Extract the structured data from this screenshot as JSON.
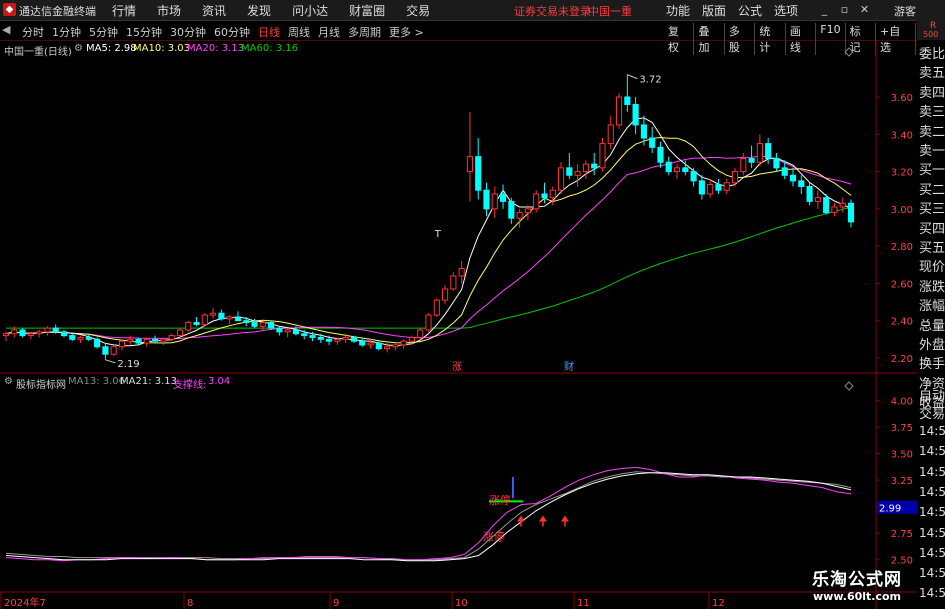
{
  "titlebar": {
    "app_name": "通达信金融终端",
    "menu": [
      "行情",
      "市场",
      "资讯",
      "发现",
      "问小达",
      "财富圈",
      "交易"
    ],
    "warning": "证券交易未登录",
    "stock": "中国一重",
    "right_menu": [
      "功能",
      "版面",
      "公式",
      "选项"
    ],
    "guest": "游客"
  },
  "periods": {
    "items": [
      "分时",
      "1分钟",
      "5分钟",
      "15分钟",
      "30分钟",
      "60分钟",
      "日线",
      "周线",
      "月线",
      "多周期",
      "更多 >"
    ],
    "active": "日线"
  },
  "toolbar": [
    "复权",
    "叠加",
    "多股",
    "统计",
    "画线",
    "F10",
    "标记",
    "+自选",
    "返回"
  ],
  "rbox": {
    "a": "R",
    "b": "500"
  },
  "main_panel": {
    "title": "中国一重(日线)",
    "ma5": "MA5: 2.98",
    "ma10": "MA10: 3.03",
    "ma20": "MA20: 3.13",
    "ma60": "MA60: 3.16",
    "y_ticks": [
      "3.60",
      "3.40",
      "3.20",
      "3.00",
      "2.80",
      "2.60",
      "2.40",
      "2.20"
    ],
    "y_range": [
      2.13,
      3.82
    ],
    "high_label": "3.72",
    "low_label": "2.19",
    "t_label": "T",
    "marker_zhang": "涨",
    "marker_cai": "财"
  },
  "sub_panel": {
    "title": "股标指标网",
    "ma13": "MA13: 3.06",
    "ma21": "MA21: 3.13",
    "support_name": "支撑线:",
    "support_val": "3.04",
    "y_ticks": [
      "4.00",
      "3.75",
      "3.50",
      "3.25",
      "3.00",
      "2.75",
      "2.50"
    ],
    "y_range": [
      2.45,
      4.1
    ],
    "current": "2.99",
    "zhangting1": "涨停",
    "zhangting2": "涨停"
  },
  "x_labels": [
    "2024年7",
    "8",
    "9",
    "10",
    "11",
    "12"
  ],
  "side_quote": [
    "委比",
    "卖五",
    "卖四",
    "卖三",
    "卖二",
    "卖一",
    "买一",
    "买二",
    "买三",
    "买四",
    "买五",
    "现价",
    "涨跌",
    "涨幅",
    "总量",
    "外盘",
    "换手",
    "净资",
    "收益"
  ],
  "side_auto": [
    "自动",
    "交易"
  ],
  "side_times": [
    "14:56",
    "14:56",
    "14:56",
    "14:56",
    "14:56",
    "14:56",
    "14:56",
    "14:56",
    "14:56"
  ],
  "watermark": {
    "line1": "乐淘公式网",
    "line2": "www.60lt.com"
  },
  "colors": {
    "up": "#ff3232",
    "down": "#00ffff",
    "ma5": "#ffffff",
    "ma10": "#ffff66",
    "ma20": "#ff40ff",
    "ma60": "#00c800",
    "axis": "#8b0000"
  },
  "chart_data": {
    "type": "candlestick",
    "candles": [
      [
        2.32,
        2.34,
        2.29,
        2.33
      ],
      [
        2.33,
        2.37,
        2.31,
        2.35
      ],
      [
        2.35,
        2.36,
        2.31,
        2.32
      ],
      [
        2.32,
        2.34,
        2.3,
        2.33
      ],
      [
        2.33,
        2.35,
        2.31,
        2.34
      ],
      [
        2.34,
        2.37,
        2.32,
        2.36
      ],
      [
        2.36,
        2.38,
        2.33,
        2.34
      ],
      [
        2.34,
        2.35,
        2.31,
        2.32
      ],
      [
        2.32,
        2.33,
        2.29,
        2.3
      ],
      [
        2.3,
        2.32,
        2.28,
        2.31
      ],
      [
        2.31,
        2.33,
        2.29,
        2.3
      ],
      [
        2.3,
        2.31,
        2.25,
        2.26
      ],
      [
        2.26,
        2.28,
        2.19,
        2.22
      ],
      [
        2.22,
        2.27,
        2.21,
        2.26
      ],
      [
        2.26,
        2.3,
        2.24,
        2.29
      ],
      [
        2.29,
        2.32,
        2.27,
        2.3
      ],
      [
        2.3,
        2.31,
        2.27,
        2.28
      ],
      [
        2.28,
        2.31,
        2.26,
        2.3
      ],
      [
        2.3,
        2.32,
        2.28,
        2.29
      ],
      [
        2.29,
        2.31,
        2.27,
        2.3
      ],
      [
        2.3,
        2.33,
        2.29,
        2.32
      ],
      [
        2.32,
        2.36,
        2.31,
        2.35
      ],
      [
        2.35,
        2.4,
        2.34,
        2.39
      ],
      [
        2.39,
        2.42,
        2.37,
        2.38
      ],
      [
        2.38,
        2.44,
        2.37,
        2.43
      ],
      [
        2.43,
        2.47,
        2.41,
        2.44
      ],
      [
        2.44,
        2.46,
        2.4,
        2.41
      ],
      [
        2.41,
        2.43,
        2.38,
        2.42
      ],
      [
        2.42,
        2.45,
        2.4,
        2.4
      ],
      [
        2.4,
        2.42,
        2.37,
        2.39
      ],
      [
        2.39,
        2.41,
        2.36,
        2.37
      ],
      [
        2.37,
        2.4,
        2.35,
        2.39
      ],
      [
        2.39,
        2.4,
        2.35,
        2.36
      ],
      [
        2.36,
        2.37,
        2.32,
        2.34
      ],
      [
        2.34,
        2.36,
        2.31,
        2.35
      ],
      [
        2.35,
        2.37,
        2.32,
        2.33
      ],
      [
        2.33,
        2.35,
        2.3,
        2.32
      ],
      [
        2.32,
        2.34,
        2.29,
        2.31
      ],
      [
        2.31,
        2.33,
        2.28,
        2.3
      ],
      [
        2.3,
        2.32,
        2.27,
        2.29
      ],
      [
        2.29,
        2.31,
        2.27,
        2.3
      ],
      [
        2.3,
        2.33,
        2.28,
        2.31
      ],
      [
        2.31,
        2.32,
        2.28,
        2.29
      ],
      [
        2.29,
        2.31,
        2.26,
        2.27
      ],
      [
        2.27,
        2.3,
        2.25,
        2.28
      ],
      [
        2.28,
        2.29,
        2.24,
        2.25
      ],
      [
        2.25,
        2.28,
        2.23,
        2.26
      ],
      [
        2.26,
        2.28,
        2.24,
        2.27
      ],
      [
        2.27,
        2.3,
        2.25,
        2.29
      ],
      [
        2.29,
        2.32,
        2.27,
        2.31
      ],
      [
        2.31,
        2.36,
        2.3,
        2.35
      ],
      [
        2.35,
        2.44,
        2.34,
        2.43
      ],
      [
        2.43,
        2.52,
        2.42,
        2.51
      ],
      [
        2.51,
        2.59,
        2.49,
        2.57
      ],
      [
        2.57,
        2.66,
        2.56,
        2.64
      ],
      [
        2.64,
        2.72,
        2.6,
        2.68
      ],
      [
        3.2,
        3.52,
        3.04,
        3.28
      ],
      [
        3.28,
        3.38,
        3.05,
        3.1
      ],
      [
        3.1,
        3.14,
        2.96,
        3.0
      ],
      [
        3.0,
        3.12,
        2.95,
        3.08
      ],
      [
        3.08,
        3.13,
        3.0,
        3.04
      ],
      [
        3.04,
        3.06,
        2.92,
        2.95
      ],
      [
        2.95,
        3.0,
        2.9,
        2.98
      ],
      [
        2.98,
        3.02,
        2.94,
        3.0
      ],
      [
        3.0,
        3.1,
        2.98,
        3.08
      ],
      [
        3.08,
        3.14,
        3.03,
        3.06
      ],
      [
        3.06,
        3.12,
        3.02,
        3.1
      ],
      [
        3.1,
        3.25,
        3.08,
        3.22
      ],
      [
        3.22,
        3.3,
        3.16,
        3.18
      ],
      [
        3.18,
        3.24,
        3.12,
        3.2
      ],
      [
        3.2,
        3.26,
        3.16,
        3.24
      ],
      [
        3.24,
        3.3,
        3.18,
        3.22
      ],
      [
        3.22,
        3.38,
        3.2,
        3.35
      ],
      [
        3.35,
        3.5,
        3.32,
        3.45
      ],
      [
        3.45,
        3.62,
        3.43,
        3.6
      ],
      [
        3.6,
        3.72,
        3.52,
        3.56
      ],
      [
        3.56,
        3.6,
        3.4,
        3.45
      ],
      [
        3.45,
        3.5,
        3.34,
        3.38
      ],
      [
        3.38,
        3.44,
        3.3,
        3.33
      ],
      [
        3.33,
        3.36,
        3.22,
        3.25
      ],
      [
        3.25,
        3.28,
        3.18,
        3.2
      ],
      [
        3.2,
        3.24,
        3.16,
        3.22
      ],
      [
        3.22,
        3.26,
        3.18,
        3.2
      ],
      [
        3.2,
        3.22,
        3.12,
        3.15
      ],
      [
        3.15,
        3.18,
        3.05,
        3.08
      ],
      [
        3.08,
        3.16,
        3.06,
        3.13
      ],
      [
        3.13,
        3.16,
        3.08,
        3.1
      ],
      [
        3.1,
        3.16,
        3.08,
        3.14
      ],
      [
        3.14,
        3.22,
        3.12,
        3.2
      ],
      [
        3.2,
        3.3,
        3.18,
        3.27
      ],
      [
        3.27,
        3.34,
        3.22,
        3.25
      ],
      [
        3.25,
        3.4,
        3.23,
        3.35
      ],
      [
        3.35,
        3.38,
        3.24,
        3.27
      ],
      [
        3.27,
        3.3,
        3.2,
        3.22
      ],
      [
        3.22,
        3.26,
        3.16,
        3.18
      ],
      [
        3.18,
        3.22,
        3.12,
        3.15
      ],
      [
        3.15,
        3.18,
        3.08,
        3.12
      ],
      [
        3.12,
        3.14,
        3.02,
        3.04
      ],
      [
        3.04,
        3.1,
        3.0,
        3.06
      ],
      [
        3.06,
        3.08,
        2.97,
        2.98
      ],
      [
        2.98,
        3.03,
        2.96,
        3.01
      ],
      [
        3.01,
        3.06,
        2.98,
        3.03
      ],
      [
        3.03,
        3.05,
        2.9,
        2.93
      ]
    ],
    "sub_lines": {
      "ma13": [
        2.52,
        2.51,
        2.5,
        2.5,
        2.49,
        2.5,
        2.5,
        2.51,
        2.52,
        2.52,
        2.51,
        2.52,
        2.52,
        2.51,
        2.5,
        2.5,
        2.5,
        2.51,
        2.52,
        2.52,
        2.52,
        2.53,
        2.53,
        2.53,
        2.52,
        2.52,
        2.51,
        2.5,
        2.5,
        2.5,
        2.51,
        2.52,
        2.55,
        2.66,
        2.82,
        2.95,
        3.02,
        3.03,
        3.1,
        3.18,
        3.25,
        3.3,
        3.34,
        3.36,
        3.37,
        3.35,
        3.31,
        3.28,
        3.28,
        3.3,
        3.29,
        3.27,
        3.26,
        3.25,
        3.23,
        3.22,
        3.2,
        3.18,
        3.14,
        3.12
      ],
      "ma21": [
        2.56,
        2.55,
        2.54,
        2.53,
        2.53,
        2.52,
        2.52,
        2.52,
        2.52,
        2.52,
        2.52,
        2.52,
        2.52,
        2.52,
        2.52,
        2.51,
        2.51,
        2.51,
        2.51,
        2.52,
        2.52,
        2.52,
        2.52,
        2.52,
        2.52,
        2.52,
        2.51,
        2.51,
        2.5,
        2.5,
        2.5,
        2.51,
        2.52,
        2.6,
        2.72,
        2.84,
        2.95,
        3.02,
        3.07,
        3.12,
        3.18,
        3.24,
        3.28,
        3.31,
        3.33,
        3.32,
        3.31,
        3.3,
        3.29,
        3.29,
        3.28,
        3.28,
        3.27,
        3.26,
        3.25,
        3.24,
        3.23,
        3.22,
        3.21,
        3.18
      ],
      "support": [
        2.54,
        2.53,
        2.52,
        2.51,
        2.5,
        2.5,
        2.5,
        2.5,
        2.51,
        2.51,
        2.51,
        2.51,
        2.51,
        2.51,
        2.5,
        2.5,
        2.5,
        2.5,
        2.5,
        2.51,
        2.51,
        2.51,
        2.51,
        2.51,
        2.51,
        2.5,
        2.5,
        2.5,
        2.49,
        2.49,
        2.49,
        2.5,
        2.51,
        2.54,
        2.64,
        2.76,
        2.86,
        2.96,
        3.04,
        3.11,
        3.17,
        3.22,
        3.26,
        3.29,
        3.31,
        3.32,
        3.32,
        3.31,
        3.3,
        3.3,
        3.29,
        3.28,
        3.28,
        3.27,
        3.26,
        3.25,
        3.24,
        3.22,
        3.19,
        3.16
      ]
    }
  }
}
